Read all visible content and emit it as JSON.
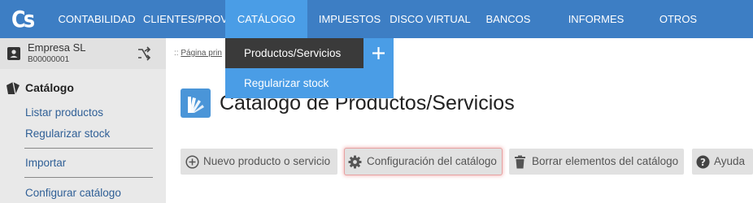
{
  "app": {
    "logo_text": "Cs"
  },
  "topnav": {
    "items": [
      {
        "label": "CONTABILIDAD"
      },
      {
        "label": "CLIENTES/PROV."
      },
      {
        "label": "CATÁLOGO"
      },
      {
        "label": "IMPUESTOS"
      },
      {
        "label": "DISCO VIRTUAL"
      },
      {
        "label": "BANCOS"
      },
      {
        "label": "INFORMES"
      },
      {
        "label": "OTROS"
      }
    ],
    "active_label": "CATÁLOGO"
  },
  "dropdown": {
    "items": [
      {
        "label": "Productos/Servicios"
      },
      {
        "label": "Regularizar stock"
      }
    ],
    "plus_icon": "plus-icon"
  },
  "company": {
    "name": "Empresa SL",
    "id": "B00000001"
  },
  "sidebar": {
    "section_title": "Catálogo",
    "items": [
      {
        "label": "Listar productos"
      },
      {
        "label": "Regularizar stock"
      },
      {
        "label": "Importar"
      },
      {
        "label": "Configurar catálogo"
      }
    ]
  },
  "breadcrumb": {
    "prefix": "::",
    "link": "Página prin"
  },
  "main": {
    "title": "Catálogo de Productos/Servicios"
  },
  "actions": {
    "new_label": "Nuevo producto o servicio",
    "config_label": "Configuración del catálogo",
    "delete_label": "Borrar elementos del catálogo",
    "help_label": "Ayuda"
  },
  "colors": {
    "topbar": "#3d7ec4",
    "active_nav": "#4a9de6",
    "dropdown_selected": "#3a3a3a",
    "link": "#2f5f96"
  }
}
